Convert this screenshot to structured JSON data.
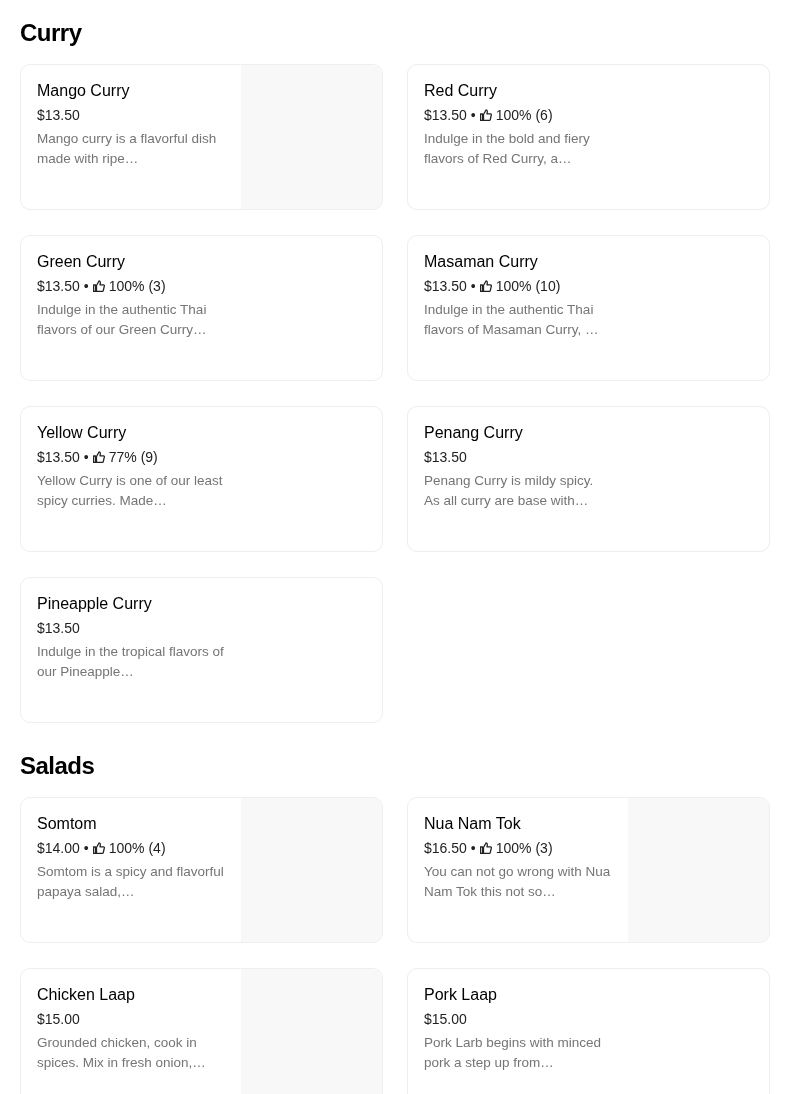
{
  "sections": [
    {
      "title": "Curry",
      "items": [
        {
          "name": "Mango Curry",
          "price": "$13.50",
          "description": "Mango curry is a flavorful dish made with ripe…",
          "image": true
        },
        {
          "name": "Red Curry",
          "price": "$13.50",
          "rating": {
            "separator": "•",
            "score": "100% (6)"
          },
          "description": "Indulge in the bold and fiery flavors of Red Curry, a…",
          "image": false
        },
        {
          "name": "Green Curry",
          "price": "$13.50",
          "rating": {
            "separator": "•",
            "score": "100% (3)"
          },
          "description": "Indulge in the authentic Thai flavors of our Green Curry…",
          "image": false
        },
        {
          "name": "Masaman Curry",
          "price": "$13.50",
          "rating": {
            "separator": "•",
            "score": "100% (10)"
          },
          "description": "Indulge in the authentic Thai flavors of Masaman Curry, …",
          "image": false
        },
        {
          "name": "Yellow Curry",
          "price": "$13.50",
          "rating": {
            "separator": "•",
            "score": "77% (9)"
          },
          "description": "Yellow Curry is one of our least spicy curries. Made…",
          "image": false
        },
        {
          "name": "Penang Curry",
          "price": "$13.50",
          "description": "Penang Curry is mildy spicy. As all curry are base with…",
          "image": false
        },
        {
          "name": "Pineapple Curry",
          "price": "$13.50",
          "description": "Indulge in the tropical flavors of our Pineapple…",
          "image": false
        }
      ]
    },
    {
      "title": "Salads",
      "items": [
        {
          "name": "Somtom",
          "price": "$14.00",
          "rating": {
            "separator": "•",
            "score": "100% (4)"
          },
          "description": "Somtom is a spicy and flavorful papaya salad,…",
          "image": true
        },
        {
          "name": "Nua Nam Tok",
          "price": "$16.50",
          "rating": {
            "separator": "•",
            "score": "100% (3)"
          },
          "description": "You can not go wrong with Nua Nam Tok this not so…",
          "image": true
        },
        {
          "name": "Chicken Laap",
          "price": "$15.00",
          "description": "Grounded chicken, cook in spices. Mix in fresh onion,…",
          "image": true
        },
        {
          "name": "Pork Laap",
          "price": "$15.00",
          "description": "Pork Larb begins with minced pork a step up from…",
          "image": false
        }
      ]
    }
  ]
}
